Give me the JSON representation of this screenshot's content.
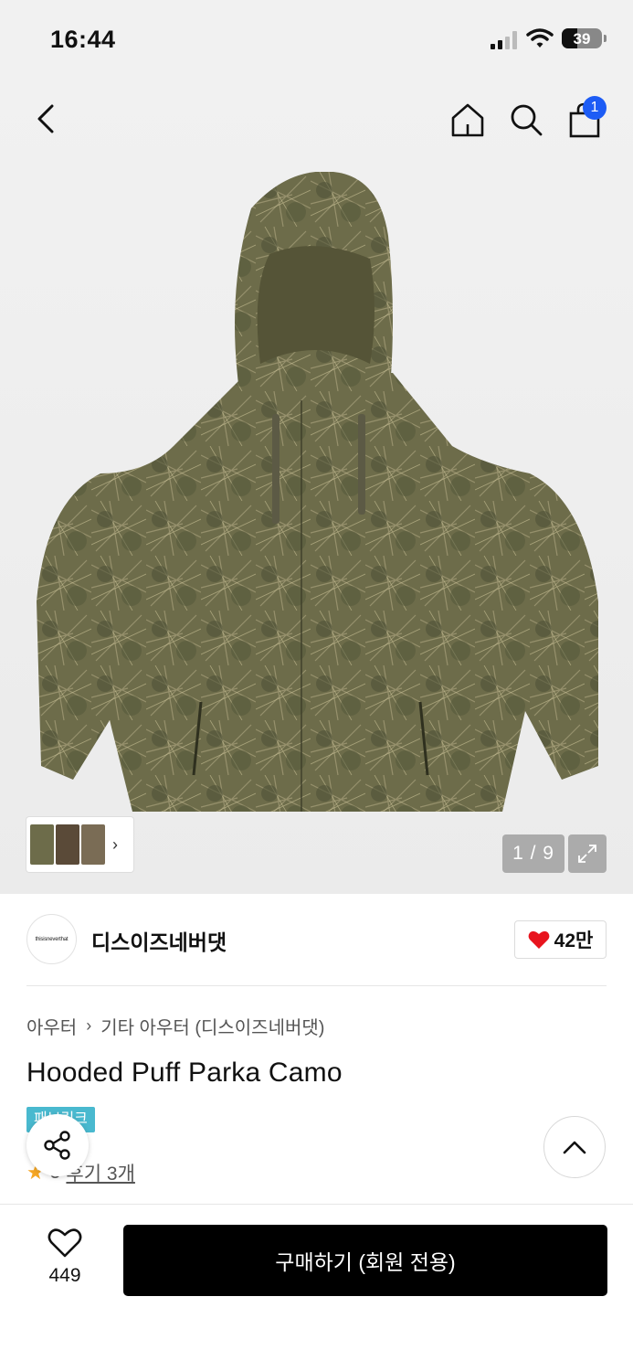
{
  "status_bar": {
    "time": "16:44",
    "battery": "39",
    "battery_level": 0.39
  },
  "header": {
    "back_icon": "chevron-left-icon",
    "home_icon": "home-icon",
    "search_icon": "search-icon",
    "cart_icon": "shopping-bag-icon",
    "cart_badge": "1",
    "cart_badge_color": "#1d5cf5"
  },
  "gallery": {
    "counter": "1 / 9",
    "expand_icon": "expand-icon"
  },
  "brand": {
    "logo_text": "thisisneverthat",
    "name": "디스이즈네버댓",
    "likes": "42만",
    "heart_color": "#e8141e"
  },
  "breadcrumb": {
    "level1": "아우터",
    "level2": "기타 아우터 (디스이즈네버댓)"
  },
  "product": {
    "title": "Hooded Puff Parka Camo",
    "tag": "패브릭크",
    "tag_color": "#49b9cf",
    "rating": "5",
    "reviews": "후기 3개"
  },
  "bottom_bar": {
    "wish_count": "449",
    "buy_label": "구매하기 (회원 전용)"
  }
}
